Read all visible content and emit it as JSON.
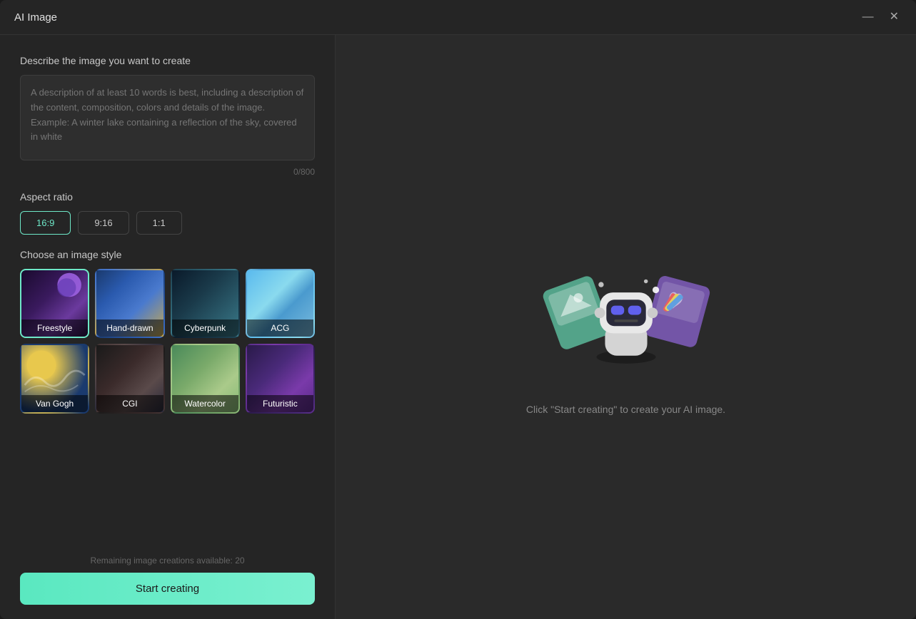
{
  "window": {
    "title": "AI Image"
  },
  "titlebar": {
    "minimize_label": "—",
    "close_label": "✕"
  },
  "left": {
    "description_label": "Describe the image you want to create",
    "description_placeholder": "A description of at least 10 words is best, including a description of the content, composition, colors and details of the image. Example: A winter lake containing a reflection of the sky, covered in white",
    "char_count": "0/800",
    "aspect_ratio_label": "Aspect ratio",
    "aspect_ratios": [
      {
        "label": "16:9",
        "active": true
      },
      {
        "label": "9:16",
        "active": false
      },
      {
        "label": "1:1",
        "active": false
      }
    ],
    "style_label": "Choose an image style",
    "styles": [
      {
        "key": "freestyle",
        "label": "Freestyle",
        "active": true
      },
      {
        "key": "handdrawn",
        "label": "Hand-drawn",
        "active": false
      },
      {
        "key": "cyberpunk",
        "label": "Cyberpunk",
        "active": false
      },
      {
        "key": "acg",
        "label": "ACG",
        "active": false
      },
      {
        "key": "vangogh",
        "label": "Van Gogh",
        "active": false
      },
      {
        "key": "cgi",
        "label": "CGI",
        "active": false
      },
      {
        "key": "watercolor",
        "label": "Watercolor",
        "active": false
      },
      {
        "key": "futuristic",
        "label": "Futuristic",
        "active": false
      }
    ],
    "remaining_text": "Remaining image creations available: 20",
    "start_button": "Start creating"
  },
  "right": {
    "hint_text": "Click \"Start creating\" to create your AI image."
  }
}
